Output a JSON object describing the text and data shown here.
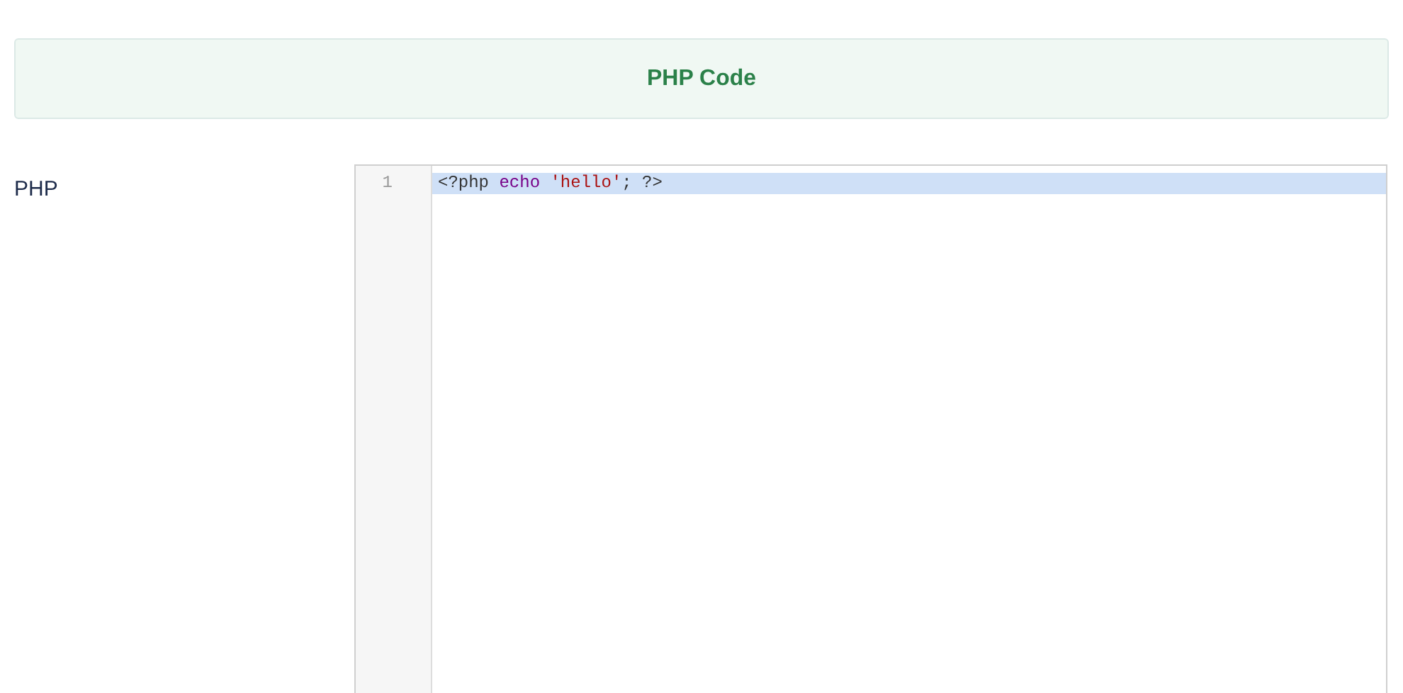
{
  "header": {
    "title": "PHP Code"
  },
  "field": {
    "label": "PHP"
  },
  "editor": {
    "lines": [
      {
        "number": "1",
        "selected": true,
        "tokens": [
          {
            "kind": "plain",
            "text": "<?php "
          },
          {
            "kind": "keyword",
            "text": "echo "
          },
          {
            "kind": "string",
            "text": "'hello'"
          },
          {
            "kind": "plain",
            "text": "; ?>"
          }
        ]
      }
    ]
  }
}
